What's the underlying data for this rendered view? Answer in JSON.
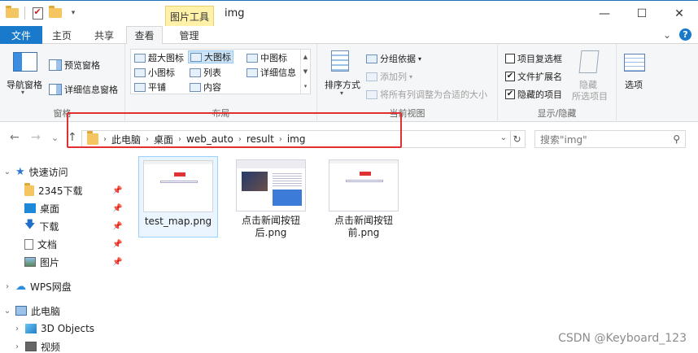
{
  "window": {
    "title": "img",
    "contextual_tab": "图片工具",
    "minimize": "—",
    "maximize": "☐",
    "close": "✕"
  },
  "tabs": {
    "file": "文件",
    "home": "主页",
    "share": "共享",
    "view": "查看",
    "manage": "管理",
    "expand": "⌄",
    "help": "?"
  },
  "ribbon": {
    "panes": {
      "label": "窗格",
      "nav_pane": "导航窗格",
      "preview_pane": "预览窗格",
      "details_pane": "详细信息窗格"
    },
    "layout": {
      "label": "布局",
      "items": [
        "超大图标",
        "大图标",
        "中图标",
        "小图标",
        "列表",
        "详细信息",
        "平铺",
        "内容"
      ],
      "selected": "大图标"
    },
    "current_view": {
      "label": "当前视图",
      "sort_by": "排序方式",
      "group_by": "分组依据",
      "add_column": "添加列",
      "fit_columns": "将所有列调整为合适的大小"
    },
    "show_hide": {
      "label": "显示/隐藏",
      "item_checkboxes": {
        "text": "项目复选框",
        "checked": false
      },
      "file_extensions": {
        "text": "文件扩展名",
        "checked": true
      },
      "hidden_items": {
        "text": "隐藏的项目",
        "checked": true
      },
      "hide_selected_1": "隐藏",
      "hide_selected_2": "所选项目"
    },
    "options": "选项"
  },
  "address": {
    "back": "←",
    "forward": "→",
    "recent": "⌄",
    "up": "↑",
    "crumbs": [
      "此电脑",
      "桌面",
      "web_auto",
      "result",
      "img"
    ],
    "search_placeholder": "搜索\"img\""
  },
  "nav": {
    "quick_access": "快速访问",
    "items": [
      {
        "label": "2345下载",
        "pinned": true
      },
      {
        "label": "桌面",
        "pinned": true
      },
      {
        "label": "下载",
        "pinned": true
      },
      {
        "label": "文档",
        "pinned": true
      },
      {
        "label": "图片",
        "pinned": true
      }
    ],
    "wps": "WPS网盘",
    "this_pc": "此电脑",
    "objects3d": "3D Objects",
    "videos": "视频"
  },
  "files": [
    {
      "name": "test_map.png",
      "selected": true
    },
    {
      "name": "点击新闻按钮后.png",
      "selected": false
    },
    {
      "name": "点击新闻按钮前.png",
      "selected": false
    }
  ],
  "watermark": "CSDN @Keyboard_123",
  "colors": {
    "file_tab": "#1979ca",
    "contextual_tab": "#fff1a8",
    "highlight_box": "#e03030",
    "selection": "#cce4f7"
  }
}
